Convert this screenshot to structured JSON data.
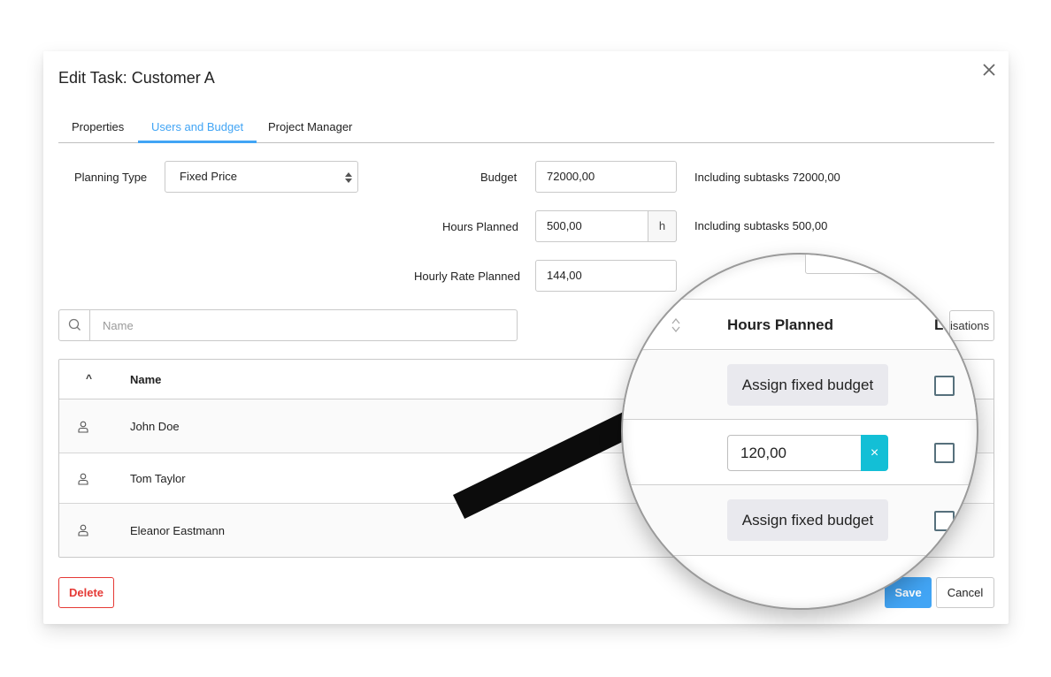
{
  "dialog": {
    "title": "Edit Task: Customer A",
    "close_icon": "close-icon"
  },
  "tabs": [
    {
      "label": "Properties",
      "active": false
    },
    {
      "label": "Users and Budget",
      "active": true
    },
    {
      "label": "Project Manager",
      "active": false
    }
  ],
  "form": {
    "planning_type": {
      "label": "Planning Type",
      "value": "Fixed Price"
    },
    "budget": {
      "label": "Budget",
      "value": "72000,00",
      "note": "Including subtasks 72000,00"
    },
    "hours_planned": {
      "label": "Hours Planned",
      "value": "500,00",
      "unit": "h",
      "note": "Including subtasks 500,00"
    },
    "hourly_rate": {
      "label": "Hourly Rate Planned",
      "value": "144,00"
    }
  },
  "search": {
    "placeholder": "Name",
    "icon": "search-icon"
  },
  "columns_button": {
    "label": "isations"
  },
  "table": {
    "sort_indicator": "^",
    "headers": {
      "name": "Name",
      "hours_planned": "Hours Planned",
      "extra": "L"
    },
    "rows": [
      {
        "name": "John Doe",
        "hours_action": "Assign fixed budget",
        "hours_value": null,
        "checked": false
      },
      {
        "name": "Tom Taylor",
        "hours_action": null,
        "hours_value": "120,00",
        "checked": false
      },
      {
        "name": "Eleanor Eastmann",
        "hours_action": "Assign fixed budget",
        "hours_value": null,
        "checked": false
      }
    ]
  },
  "footer": {
    "delete_label": "Delete",
    "save_label": "Save",
    "cancel_label": "Cancel"
  },
  "colors": {
    "accent": "#42a5f5",
    "danger": "#e53935",
    "clear_button": "#13bfd6"
  },
  "magnifier": {
    "clear_symbol": "×"
  }
}
